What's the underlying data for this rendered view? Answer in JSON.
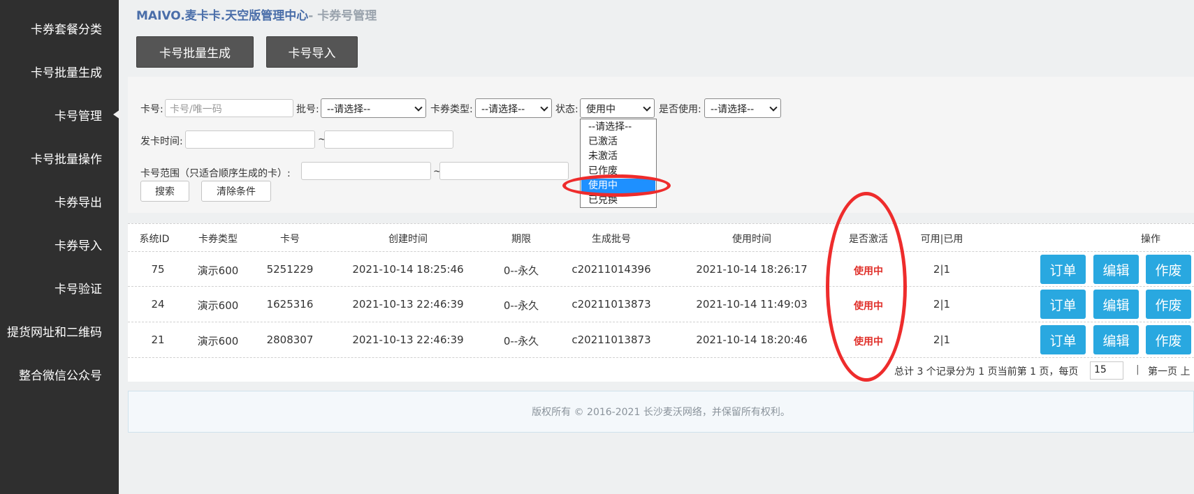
{
  "sidebar": {
    "items": [
      {
        "label": "卡券套餐分类"
      },
      {
        "label": "卡号批量生成"
      },
      {
        "label": "卡号管理"
      },
      {
        "label": "卡号批量操作"
      },
      {
        "label": "卡券导出"
      },
      {
        "label": "卡券导入"
      },
      {
        "label": "卡号验证"
      },
      {
        "label": "提货网址和二维码"
      },
      {
        "label": "整合微信公众号"
      }
    ],
    "active": "卡号管理"
  },
  "header": {
    "title": "MAIVO.麦卡卡.天空版管理中心",
    "subtitle": "- 卡券号管理"
  },
  "toolbar": {
    "batch_generate": "卡号批量生成",
    "import": "卡号导入"
  },
  "filters": {
    "card_no_label": "卡号:",
    "card_no_placeholder": "卡号/唯一码",
    "batch_label": "批号:",
    "batch_value": "--请选择--",
    "type_label": "卡券类型:",
    "type_value": "--请选择--",
    "status_label": "状态:",
    "status_value": "使用中",
    "used_label": "是否使用:",
    "used_value": "--请选择--",
    "issue_time_label": "发卡时间:",
    "tilde": "~",
    "range_label": "卡号范围（只适合顺序生成的卡）:",
    "search_button": "搜索",
    "clear_button": "清除条件"
  },
  "status_dropdown": {
    "options": [
      "--请选择--",
      "已激活",
      "未激活",
      "已作废",
      "使用中",
      "已兑换"
    ],
    "highlighted": "使用中"
  },
  "table": {
    "headers": [
      "系统ID",
      "卡券类型",
      "卡号",
      "创建时间",
      "期限",
      "生成批号",
      "使用时间",
      "是否激活",
      "可用|已用",
      "操作"
    ],
    "rows": [
      {
        "id": "75",
        "type": "演示600",
        "card_no": "5251229",
        "created": "2021-10-14 18:25:46",
        "term": "0--永久",
        "batch": "c20211014396",
        "used_time": "2021-10-14 18:26:17",
        "active": "使用中",
        "avail_used": "2|1"
      },
      {
        "id": "24",
        "type": "演示600",
        "card_no": "1625316",
        "created": "2021-10-13 22:46:39",
        "term": "0--永久",
        "batch": "c20211013873",
        "used_time": "2021-10-14 11:49:03",
        "active": "使用中",
        "avail_used": "2|1"
      },
      {
        "id": "21",
        "type": "演示600",
        "card_no": "2808307",
        "created": "2021-10-13 22:46:39",
        "term": "0--永久",
        "batch": "c20211013873",
        "used_time": "2021-10-14 18:20:46",
        "active": "使用中",
        "avail_used": "2|1"
      }
    ],
    "actions": {
      "order": "订单",
      "edit": "编辑",
      "void": "作废"
    }
  },
  "pagination": {
    "summary": "总计 3 个记录分为 1 页当前第 1 页，每页",
    "page_size": "15",
    "first_page": "第一页 上"
  },
  "footer": {
    "copyright": "版权所有 © 2016-2021 长沙麦沃网络，并保留所有权利。"
  },
  "colors": {
    "sidebar_bg": "#2f2f2f",
    "title_blue": "#4a6ea9",
    "action_blue": "#29a8e0",
    "status_red": "#e0302a",
    "annotation_red": "#ee2c2c",
    "dropdown_highlight": "#1e90ff"
  }
}
